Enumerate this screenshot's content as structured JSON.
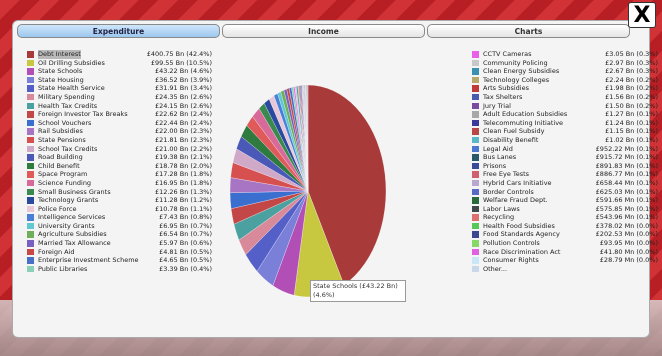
{
  "tabs": [
    {
      "label": "Expenditure"
    },
    {
      "label": "Income"
    },
    {
      "label": "Charts"
    }
  ],
  "close_label": "X",
  "tooltip": {
    "line1": "State Schools (£43.22 Bn)",
    "line2": "(4.6%)"
  },
  "left_items": [
    {
      "label": "Debt Interest",
      "value": "£400.75 Bn (42.4%)",
      "color": "#a83a3a"
    },
    {
      "label": "Oil Drilling Subsidies",
      "value": "£99.55 Bn (10.5%)",
      "color": "#c8c840"
    },
    {
      "label": "State Schools",
      "value": "£43.22 Bn (4.6%)",
      "color": "#b24fb7"
    },
    {
      "label": "State Housing",
      "value": "£36.52 Bn (3.9%)",
      "color": "#7a7fd8"
    },
    {
      "label": "State Health Service",
      "value": "£31.91 Bn (3.4%)",
      "color": "#5460c8"
    },
    {
      "label": "Military Spending",
      "value": "£24.35 Bn (2.6%)",
      "color": "#d88a9a"
    },
    {
      "label": "Health Tax Credits",
      "value": "£24.15 Bn (2.6%)",
      "color": "#4ba0a0"
    },
    {
      "label": "Foreign Investor Tax Breaks",
      "value": "£22.62 Bn (2.4%)",
      "color": "#c44747"
    },
    {
      "label": "School Vouchers",
      "value": "£22.44 Bn (2.4%)",
      "color": "#3a6fd0"
    },
    {
      "label": "Rail Subsidies",
      "value": "£22.00 Bn (2.3%)",
      "color": "#a874c4"
    },
    {
      "label": "State Pensions",
      "value": "£21.81 Bn (2.3%)",
      "color": "#d65050"
    },
    {
      "label": "School Tax Credits",
      "value": "£21.00 Bn (2.2%)",
      "color": "#d0a8c8"
    },
    {
      "label": "Road Building",
      "value": "£19.38 Bn (2.1%)",
      "color": "#4a58b8"
    },
    {
      "label": "Child Benefit",
      "value": "£18.78 Bn (2.0%)",
      "color": "#2f7a3f"
    },
    {
      "label": "Space Program",
      "value": "£17.28 Bn (1.8%)",
      "color": "#e05a5a"
    },
    {
      "label": "Science Funding",
      "value": "£16.95 Bn (1.8%)",
      "color": "#d86a9a"
    },
    {
      "label": "Small Business Grants",
      "value": "£12.26 Bn (1.3%)",
      "color": "#3a8a50"
    },
    {
      "label": "Technology Grants",
      "value": "£11.28 Bn (1.2%)",
      "color": "#2a4aa0"
    },
    {
      "label": "Police Force",
      "value": "£10.78 Bn (1.1%)",
      "color": "#e8c8d8"
    },
    {
      "label": "Intelligence Services",
      "value": "£7.43 Bn (0.8%)",
      "color": "#4880d8"
    },
    {
      "label": "University Grants",
      "value": "£6.95 Bn (0.7%)",
      "color": "#60c8d0"
    },
    {
      "label": "Agriculture Subsidies",
      "value": "£6.54 Bn (0.7%)",
      "color": "#6fae5a"
    },
    {
      "label": "Married Tax Allowance",
      "value": "£5.97 Bn (0.6%)",
      "color": "#7860c0"
    },
    {
      "label": "Foreign Aid",
      "value": "£4.81 Bn (0.5%)",
      "color": "#c84848"
    },
    {
      "label": "Enterprise Investment Scheme",
      "value": "£4.65 Bn (0.5%)",
      "color": "#4870c8"
    },
    {
      "label": "Public Libraries",
      "value": "£3.39 Bn (0.4%)",
      "color": "#8ad0b8"
    }
  ],
  "right_items": [
    {
      "label": "CCTV Cameras",
      "value": "£3.05 Bn (0.3%)",
      "color": "#e860e8"
    },
    {
      "label": "Community Policing",
      "value": "£2.97 Bn (0.3%)",
      "color": "#c8c8c8"
    },
    {
      "label": "Clean Energy Subsidies",
      "value": "£2.67 Bn (0.3%)",
      "color": "#3a90b0"
    },
    {
      "label": "Technology Colleges",
      "value": "£2.24 Bn (0.2%)",
      "color": "#b8a86a"
    },
    {
      "label": "Arts Subsidies",
      "value": "£1.98 Bn (0.2%)",
      "color": "#c03a3a"
    },
    {
      "label": "Tax Shelters",
      "value": "£1.56 Bn (0.2%)",
      "color": "#4a5ab0"
    },
    {
      "label": "Jury Trial",
      "value": "£1.50 Bn (0.2%)",
      "color": "#7a4aa0"
    },
    {
      "label": "Adult Education Subsidies",
      "value": "£1.27 Bn (0.1%)",
      "color": "#a8a8a8"
    },
    {
      "label": "Telecommuting Initiative",
      "value": "£1.24 Bn (0.1%)",
      "color": "#3a3a9a"
    },
    {
      "label": "Clean Fuel Subsidy",
      "value": "£1.15 Bn (0.1%)",
      "color": "#b84848"
    },
    {
      "label": "Disability Benefit",
      "value": "£1.02 Bn (0.1%)",
      "color": "#58b8c8"
    },
    {
      "label": "Legal Aid",
      "value": "£952.22 Mn (0.1%)",
      "color": "#4a78d0"
    },
    {
      "label": "Bus Lanes",
      "value": "£915.72 Mn (0.1%)",
      "color": "#2a5a6a"
    },
    {
      "label": "Prisons",
      "value": "£891.83 Mn (0.1%)",
      "color": "#3a4a9a"
    },
    {
      "label": "Free Eye Tests",
      "value": "£886.77 Mn (0.1%)",
      "color": "#d06070"
    },
    {
      "label": "Hybrid Cars Initiative",
      "value": "£658.44 Mn (0.1%)",
      "color": "#b8a8d0"
    },
    {
      "label": "Border Controls",
      "value": "£625.03 Mn (0.1%)",
      "color": "#5a68c8"
    },
    {
      "label": "Welfare Fraud Dept.",
      "value": "£591.66 Mn (0.1%)",
      "color": "#2a6a3a"
    },
    {
      "label": "Labor Laws",
      "value": "£575.85 Mn (0.1%)",
      "color": "#404848"
    },
    {
      "label": "Recycling",
      "value": "£543.96 Mn (0.1%)",
      "color": "#e07070"
    },
    {
      "label": "Health Food Subsidies",
      "value": "£378.02 Mn (0.0%)",
      "color": "#58c858"
    },
    {
      "label": "Food Standards Agency",
      "value": "£202.53 Mn (0.0%)",
      "color": "#3a4890"
    },
    {
      "label": "Pollution Controls",
      "value": "£93.95 Mn (0.0%)",
      "color": "#88d868"
    },
    {
      "label": "Race Discrimination Act",
      "value": "£41.80 Mn (0.0%)",
      "color": "#e060e0"
    },
    {
      "label": "Consumer Rights",
      "value": "£28.79 Mn (0.0%)",
      "color": "#c8e8f8"
    },
    {
      "label": "Other...",
      "value": "",
      "color": "#c8d8e8"
    }
  ],
  "chart_data": {
    "type": "pie",
    "slices": [
      {
        "label": "Debt Interest",
        "value": 42.4
      },
      {
        "label": "Oil Drilling Subsidies",
        "value": 10.5
      },
      {
        "label": "State Schools",
        "value": 4.6
      },
      {
        "label": "State Housing",
        "value": 3.9
      },
      {
        "label": "State Health Service",
        "value": 3.4
      },
      {
        "label": "Military Spending",
        "value": 2.6
      },
      {
        "label": "Health Tax Credits",
        "value": 2.6
      },
      {
        "label": "Foreign Investor Tax Breaks",
        "value": 2.4
      },
      {
        "label": "School Vouchers",
        "value": 2.4
      },
      {
        "label": "Rail Subsidies",
        "value": 2.3
      },
      {
        "label": "State Pensions",
        "value": 2.3
      },
      {
        "label": "School Tax Credits",
        "value": 2.2
      },
      {
        "label": "Road Building",
        "value": 2.1
      },
      {
        "label": "Child Benefit",
        "value": 2.0
      },
      {
        "label": "Space Program",
        "value": 1.8
      },
      {
        "label": "Science Funding",
        "value": 1.8
      },
      {
        "label": "Small Business Grants",
        "value": 1.3
      },
      {
        "label": "Technology Grants",
        "value": 1.2
      },
      {
        "label": "Police Force",
        "value": 1.1
      },
      {
        "label": "Intelligence Services",
        "value": 0.8
      },
      {
        "label": "University Grants",
        "value": 0.7
      },
      {
        "label": "Agriculture Subsidies",
        "value": 0.7
      },
      {
        "label": "Married Tax Allowance",
        "value": 0.6
      },
      {
        "label": "Foreign Aid",
        "value": 0.5
      },
      {
        "label": "Enterprise Investment Scheme",
        "value": 0.5
      },
      {
        "label": "Public Libraries",
        "value": 0.4
      },
      {
        "label": "CCTV Cameras",
        "value": 0.3
      },
      {
        "label": "Community Policing",
        "value": 0.3
      },
      {
        "label": "Clean Energy Subsidies",
        "value": 0.3
      },
      {
        "label": "Technology Colleges",
        "value": 0.2
      },
      {
        "label": "Arts Subsidies",
        "value": 0.2
      },
      {
        "label": "Tax Shelters",
        "value": 0.2
      },
      {
        "label": "Jury Trial",
        "value": 0.2
      },
      {
        "label": "Adult Education Subsidies",
        "value": 0.1
      },
      {
        "label": "Telecommuting Initiative",
        "value": 0.1
      },
      {
        "label": "Clean Fuel Subsidy",
        "value": 0.1
      },
      {
        "label": "Disability Benefit",
        "value": 0.1
      },
      {
        "label": "Legal Aid",
        "value": 0.1
      },
      {
        "label": "Bus Lanes",
        "value": 0.1
      },
      {
        "label": "Prisons",
        "value": 0.1
      },
      {
        "label": "Free Eye Tests",
        "value": 0.1
      },
      {
        "label": "Hybrid Cars Initiative",
        "value": 0.1
      },
      {
        "label": "Border Controls",
        "value": 0.1
      },
      {
        "label": "Welfare Fraud Dept.",
        "value": 0.1
      },
      {
        "label": "Labor Laws",
        "value": 0.1
      },
      {
        "label": "Recycling",
        "value": 0.1
      }
    ]
  }
}
